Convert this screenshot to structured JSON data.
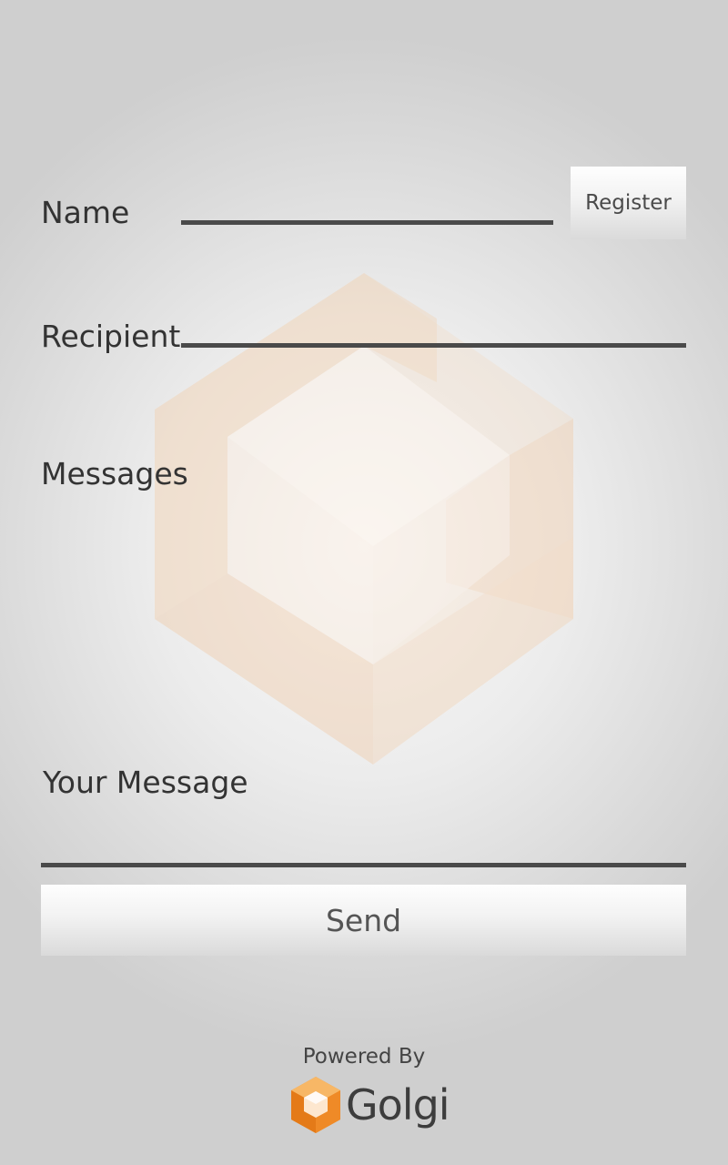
{
  "form": {
    "name_label": "Name",
    "name_value": "",
    "register_label": "Register",
    "recipient_label": "Recipient",
    "recipient_value": "",
    "messages_label": "Messages",
    "your_message_label": "Your Message",
    "your_message_value": "",
    "send_label": "Send"
  },
  "footer": {
    "powered_by": "Powered By",
    "brand_name": "Golgi",
    "logo_icon": "golgi-cube-icon"
  },
  "colors": {
    "input_underline": "#4a4a4a",
    "text": "#333333",
    "brand_orange": "#f08a24"
  }
}
